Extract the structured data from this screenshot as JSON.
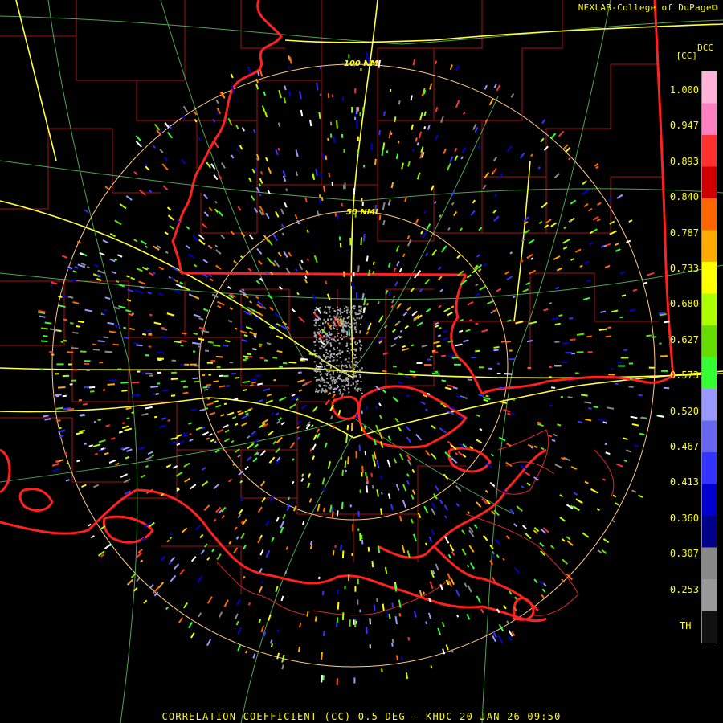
{
  "header": {
    "credit": "NEXLAB-College of DuPage",
    "credit_icon": "external-link-icon",
    "product_code": "DCC",
    "unit": "[CC]"
  },
  "range_rings": [
    {
      "label": "100 NMI"
    },
    {
      "label": "50 NMI"
    }
  ],
  "color_scale": {
    "labels": [
      "1.000",
      "0.947",
      "0.893",
      "0.840",
      "0.787",
      "0.733",
      "0.680",
      "0.627",
      "0.573",
      "0.520",
      "0.467",
      "0.413",
      "0.360",
      "0.307",
      "0.253"
    ],
    "bottom_label": "TH",
    "colors_top_to_bottom": [
      "#ffb3d9",
      "#ff80c0",
      "#ff3030",
      "#cc0000",
      "#ff6600",
      "#ffaa00",
      "#ffff00",
      "#aaff00",
      "#66dd00",
      "#33ff33",
      "#9999ff",
      "#6666ee",
      "#3333ff",
      "#0000cc",
      "#000088",
      "#888888",
      "#999999",
      "#111111"
    ]
  },
  "footer": {
    "title": "CORRELATION COEFFICIENT (CC) 0.5 DEG - KHDC 20 JAN 26 09:50"
  },
  "colors": {
    "text": "#ffff00",
    "state_lines": "#ff2020",
    "county_lines": "#aa1010",
    "highways": "#ffff44",
    "roads": "#88ff88",
    "rings": "#ffcc88"
  }
}
